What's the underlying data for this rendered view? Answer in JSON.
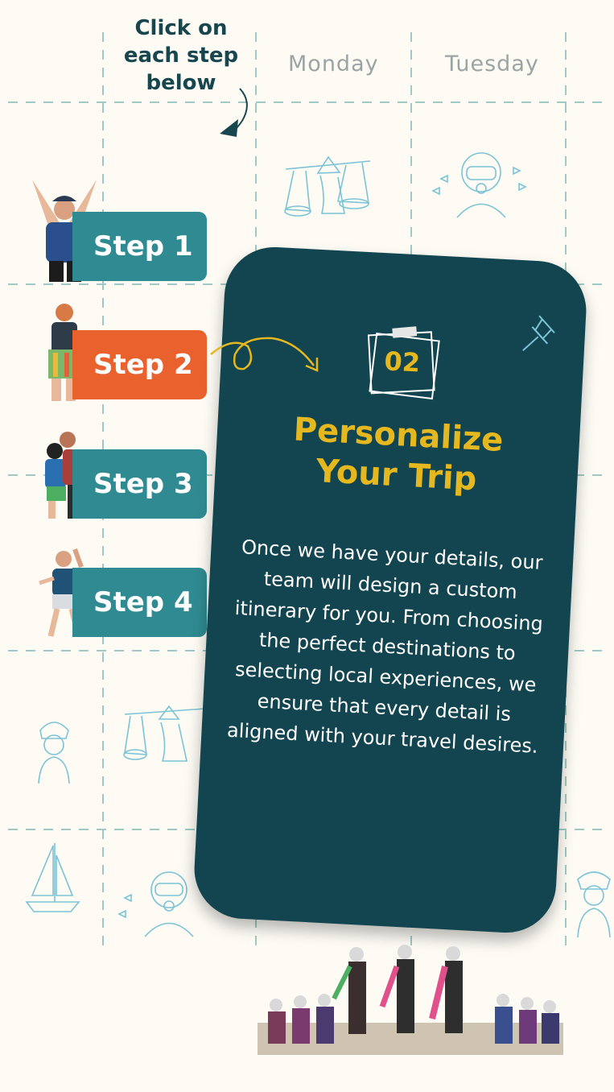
{
  "hint": {
    "lines": [
      "Click on",
      "each step",
      "below"
    ]
  },
  "days": [
    "Monday",
    "Tuesday"
  ],
  "steps": [
    {
      "label": "Step 1",
      "active": false
    },
    {
      "label": "Step 2",
      "active": true
    },
    {
      "label": "Step 3",
      "active": false
    },
    {
      "label": "Step 4",
      "active": false
    }
  ],
  "card": {
    "number": "02",
    "title_lines": [
      "Personalize",
      "Your Trip"
    ],
    "body": "Once we have your details, our team will design a custom itinerary for you. From choosing the perfect destinations to selecting local experiences, we ensure that every detail is aligned with your travel desires."
  },
  "colors": {
    "background": "#fdfbf4",
    "teal": "#2f8b91",
    "orange": "#e9612c",
    "card": "#12454f",
    "gold": "#e5b81f",
    "sketch": "#7cc3d6"
  },
  "icons": [
    "arrow-down-icon",
    "curly-arrow-icon",
    "pushpin-icon",
    "sticky-note-icon"
  ]
}
